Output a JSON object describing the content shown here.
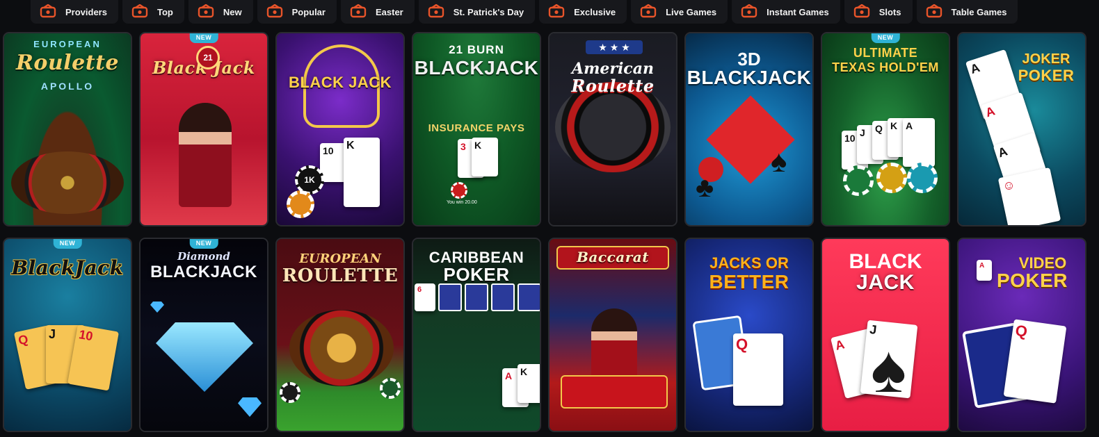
{
  "nav": {
    "items": [
      {
        "label": "Providers",
        "icon": "providers-icon"
      },
      {
        "label": "Top",
        "icon": "top-icon"
      },
      {
        "label": "New",
        "icon": "new-icon"
      },
      {
        "label": "Popular",
        "icon": "popular-icon"
      },
      {
        "label": "Easter",
        "icon": "easter-icon"
      },
      {
        "label": "St. Patrick's Day",
        "icon": "st-patricks-icon"
      },
      {
        "label": "Exclusive",
        "icon": "exclusive-icon"
      },
      {
        "label": "Live Games",
        "icon": "live-games-icon"
      },
      {
        "label": "Instant Games",
        "icon": "instant-games-icon"
      },
      {
        "label": "Slots",
        "icon": "slots-icon"
      },
      {
        "label": "Table Games",
        "icon": "table-games-icon"
      }
    ],
    "icon_color": "#e8542a"
  },
  "badge_label": "NEW",
  "games": [
    {
      "title": "Roulette",
      "pre": "EUROPEAN",
      "sub": "APOLLO",
      "new": false
    },
    {
      "title": "Black Jack",
      "pre": "",
      "sub": "",
      "new": true,
      "chip": "21"
    },
    {
      "title": "BLACK JACK",
      "pre": "",
      "sub": "",
      "new": false,
      "chip": "1K"
    },
    {
      "title": "BLACKJACK",
      "pre": "21 BURN",
      "sub": "INSURANCE PAYS",
      "new": false,
      "note": "You win 20.00"
    },
    {
      "title": "Roulette",
      "pre": "American",
      "sub": "",
      "new": false
    },
    {
      "title": "BLACKJACK",
      "pre": "3D",
      "sub": "",
      "new": false
    },
    {
      "title": "TEXAS HOLD'EM",
      "pre": "ULTIMATE",
      "sub": "",
      "new": true
    },
    {
      "title": "POKER",
      "pre": "JOKER",
      "sub": "",
      "new": false
    },
    {
      "title": "BlackJack",
      "pre": "",
      "sub": "",
      "new": true
    },
    {
      "title": "BLACKJACK",
      "pre": "Diamond",
      "sub": "",
      "new": true
    },
    {
      "title": "ROULETTE",
      "pre": "EUROPEAN",
      "sub": "",
      "new": false
    },
    {
      "title": "POKER",
      "pre": "CARIBBEAN",
      "sub": "",
      "new": false
    },
    {
      "title": "Baccarat",
      "pre": "",
      "sub": "",
      "new": false
    },
    {
      "title": "BETTER",
      "pre": "JACKS OR",
      "sub": "",
      "new": false
    },
    {
      "title": "JACK",
      "pre": "BLACK",
      "sub": "",
      "new": false
    },
    {
      "title": "POKER",
      "pre": "VIDEO",
      "sub": "",
      "new": false
    }
  ]
}
